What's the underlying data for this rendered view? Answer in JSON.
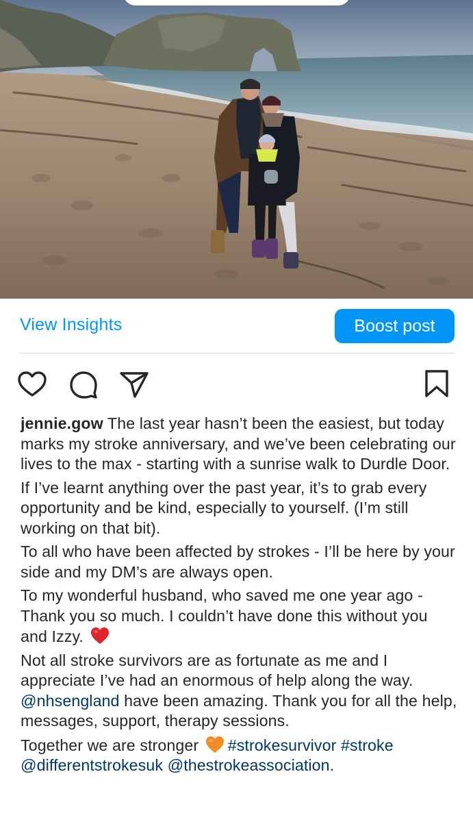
{
  "post": {
    "photo_alt": "photo-of-family-on-beach-at-durdle-door"
  },
  "insights": {
    "view_insights_label": "View Insights",
    "boost_post_label": "Boost post"
  },
  "actions": {
    "like_icon": "heart-outline-icon",
    "comment_icon": "comment-bubble-icon",
    "share_icon": "paper-plane-icon",
    "save_icon": "bookmark-icon"
  },
  "caption": {
    "username": "jennie.gow",
    "p1": " The last year hasn’t been the easiest, but today marks my stroke anniversary, and we’ve been celebrating our lives to the max - starting with a sunrise walk to Durdle Door.",
    "p2": "If I’ve learnt anything over the past year, it’s to grab every opportunity and be kind, especially to yourself. (I’m still working on that bit).",
    "p3": "To all who have been affected by strokes - I’ll be here by your side and my DM’s are always open.",
    "p4": "To my wonderful husband, who saved me one year ago - Thank you so much. I couldn’t have done this without you and Izzy.",
    "p5_a": "Not all stroke survivors are as fortunate as me and I appreciate I’ve had an enormous of help along the way.",
    "mention_nhs": "@nhsengland",
    "p5_b": " have been amazing. Thank you for all the help, messages, support, therapy sessions.",
    "p6_a": "Together we are stronger",
    "hashtag1": "#strokesurvivor",
    "hashtag2": "#stroke",
    "mention_diff": "@differentstrokesuk",
    "mention_assoc": "@thestrokeassociation",
    "p6_end": "."
  },
  "colors": {
    "accent_blue": "#0095f6",
    "link_dark_blue": "#00376b",
    "text": "#262626",
    "red_heart": "#e0242b",
    "orange_heart": "#f28c28"
  }
}
